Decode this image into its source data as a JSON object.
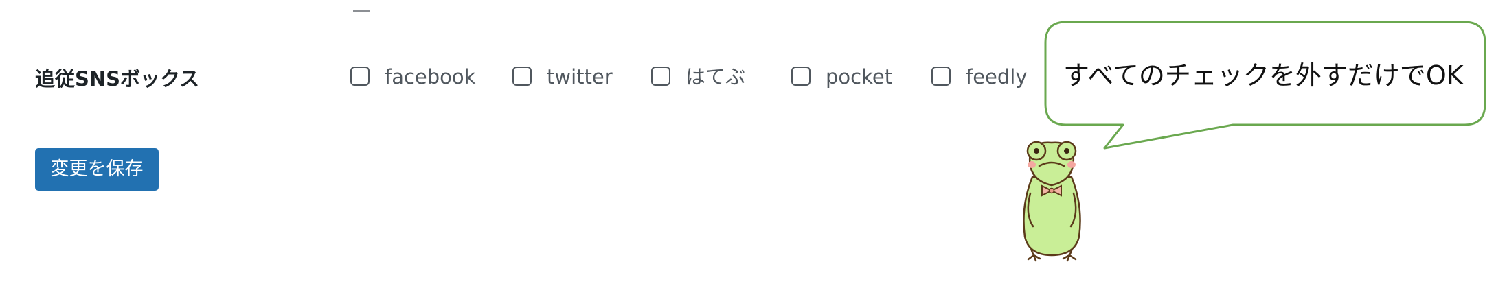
{
  "settings": {
    "follow_sns_label": "追従SNSボックス",
    "options": [
      {
        "label": "facebook",
        "checked": false
      },
      {
        "label": "twitter",
        "checked": false
      },
      {
        "label": "はてぶ",
        "checked": false
      },
      {
        "label": "pocket",
        "checked": false
      },
      {
        "label": "feedly",
        "checked": false
      }
    ],
    "save_label": "変更を保存"
  },
  "callout": {
    "text": "すべてのチェックを外すだけでOK",
    "border_color": "#6aa84f"
  },
  "colors": {
    "button": "#2271b1",
    "frog_body": "#c9ee97",
    "frog_outline": "#5b3a1a",
    "frog_cheek": "#f4a7a0",
    "bowtie": "#f3b6a6"
  }
}
